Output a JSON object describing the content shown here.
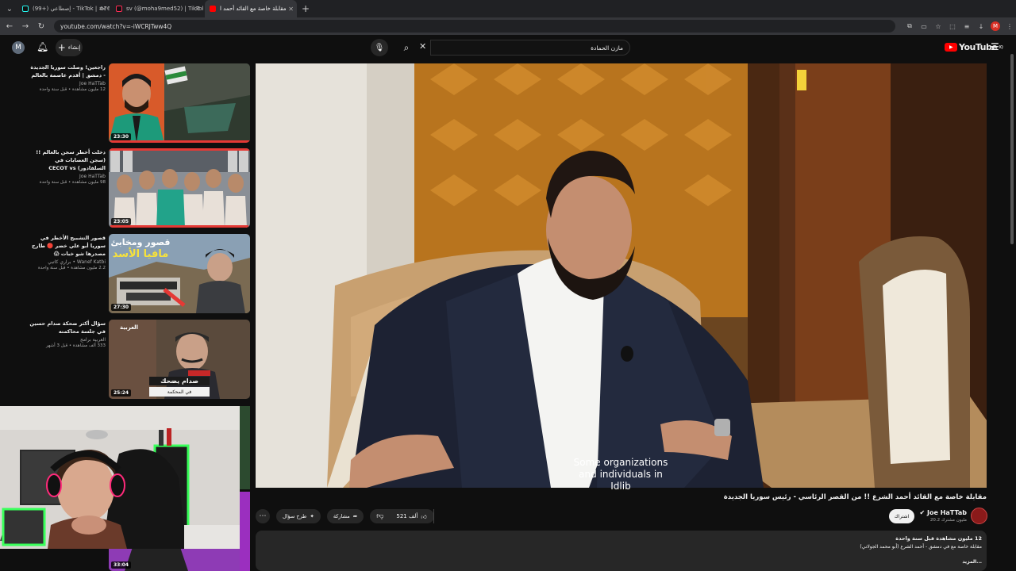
{
  "browser": {
    "tabs": [
      {
        "label": "(99+) إصطاعي - TikTok | #76",
        "active": false
      },
      {
        "label": "sv (@moha9med52) | TikTok",
        "active": false
      },
      {
        "label": "مقابلة خاصة مع القائد أحمد ا",
        "active": true
      }
    ],
    "url": "youtube.com/watch?v=-iWCRJTww4Q"
  },
  "header": {
    "avatar_letter": "M",
    "create_label": "إنشاء",
    "search_value": "مازن الحمادة",
    "logo_text": "YouTube",
    "logo_region": "IQ"
  },
  "video": {
    "subtitle_line1": "Some organizations",
    "subtitle_line2": "and individuals in Idlib",
    "title": "مقابلة خاصة مع القائد أحمد الشرع !! من القصر الرئاسي - رئيس سوريا الجديدة",
    "likes": "521 ألف",
    "share_label": "مشاركة",
    "ask_label": "طرح سؤال",
    "more_icon": "⋯"
  },
  "channel": {
    "name": "Joe HaTTab",
    "subs": "20.2 مليون مشترك",
    "subscribe_label": "اشتراك"
  },
  "description": {
    "stats": "12 مليون مشاهدة  قبل سنة واحدة",
    "line1": "مقابلة خاصة مع في دمشق - أحمد الشرع  (أبو محمد الجولاني)",
    "more": "...المزيد"
  },
  "recommendations": [
    {
      "title": "راجعين! وصلت سوريا الجديدة - دمشق | أقدم عاصمة بالعالم",
      "channel": "Joe HaTTab",
      "views": "12 مليون مشاهدة • قبل سنة واحدة",
      "duration": "23:30"
    },
    {
      "title": "دخلت أخطر سجن بالعالم !! (سجن العصابات في السلفادور) CECOT vs",
      "channel": "Joe HaTTab",
      "views": "98 مليون مشاهدة • قبل سنة واحدة",
      "duration": "23:05"
    },
    {
      "title": "قصور التشبيح الأخطر في سوريا أبو علي خضر 🔴 طارح مصدرها شو خبات 😱",
      "channel": "Wanef Katbi • براري كاتبي",
      "views": "2.2 مليون مشاهدة • قبل سنة واحدة",
      "duration": "27:30"
    },
    {
      "title": "سؤال أكثر ضحكة صدام حسين في جلسة محاكمته",
      "channel": "العربية برامج",
      "views": "333 ألف مشاهدة • قبل 3 أشهر",
      "duration": "25:24"
    },
    {
      "title": "",
      "channel": "",
      "views": "",
      "duration": "33:04"
    }
  ],
  "thumb_texts": {
    "mafia_line1": "قصور ومخابئ",
    "mafia_line2": "مافيا الأسد",
    "saddam_line1": "صدام يضحك",
    "saddam_line2": "في المحكمة",
    "saddam_brand": "العربية"
  }
}
